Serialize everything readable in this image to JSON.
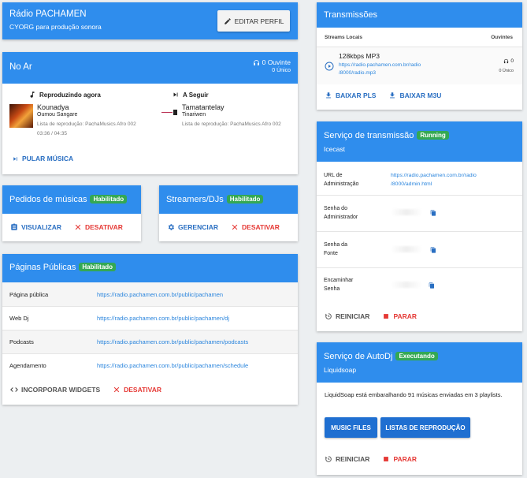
{
  "station": {
    "title": "Rádio PACHAMEN",
    "subtitle": "CYORG para produção sonora",
    "edit_label": "EDITAR PERFIL"
  },
  "onair": {
    "title": "No Ar",
    "listeners": "0 Ouvinte",
    "unique": "0 Único",
    "now_label": "Reproduzindo agora",
    "now_song": "Kounadya",
    "now_artist": "Oumou Sangare",
    "now_playlist": "Lista de reprodução: PachaMusics Afro 002",
    "now_time": "03:36 / 04:35",
    "next_label": "A Seguir",
    "next_song": "Tamatantelay",
    "next_artist": "Tinariwen",
    "next_playlist": "Lista de reprodução: PachaMusics Afro 002",
    "skip_label": "PULAR MÚSICA"
  },
  "requests": {
    "title": "Pedidos de músicas",
    "badge": "Habilitado",
    "view_label": "VISUALIZAR",
    "disable_label": "DESATIVAR"
  },
  "streamers": {
    "title": "Streamers/DJs",
    "badge": "Habilitado",
    "manage_label": "GERENCIAR",
    "disable_label": "DESATIVAR"
  },
  "public_pages": {
    "title": "Páginas Públicas",
    "badge": "Habilitado",
    "rows": [
      {
        "label": "Página pública",
        "url": "https://radio.pachamen.com.br/public/pachamen"
      },
      {
        "label": "Web Dj",
        "url": "https://radio.pachamen.com.br/public/pachamen/dj"
      },
      {
        "label": "Podcasts",
        "url": "https://radio.pachamen.com.br/public/pachamen/podcasts"
      },
      {
        "label": "Agendamento",
        "url": "https://radio.pachamen.com.br/public/pachamen/schedule"
      }
    ],
    "embed_label": "INCORPORAR WIDGETS",
    "disable_label": "DESATIVAR"
  },
  "streams": {
    "title": "Transmissões",
    "col_local": "Streams Locais",
    "col_listeners": "Ouvintes",
    "stream_name": "128kbps MP3",
    "stream_url_1": "https://radio.pachamen.com.br/radio",
    "stream_url_2": "/8000/radio.mp3",
    "stream_listeners": "0",
    "stream_unique": "0 Único",
    "pls_label": "BAIXAR PLS",
    "m3u_label": "BAIXAR M3U"
  },
  "broadcast": {
    "title": "Serviço de transmissão",
    "badge": "Running",
    "subtitle": "Icecast",
    "admin_url_label_1": "URL de",
    "admin_url_label_2": "Administração",
    "admin_url_1": "https://radio.pachamen.com.br/radio",
    "admin_url_2": "/8000/admin.html",
    "admin_pw_label_1": "Senha do",
    "admin_pw_label_2": "Administrador",
    "source_pw_label_1": "Senha da",
    "source_pw_label_2": "Fonte",
    "relay_pw_label_1": "Encaminhar",
    "relay_pw_label_2": "Senha",
    "restart_label": "REINICIAR",
    "stop_label": "PARAR"
  },
  "autodj": {
    "title": "Serviço de AutoDj",
    "badge": "Executando",
    "subtitle": "Liquidsoap",
    "desc": "LiquidSoap está embaralhando 91 músicas enviadas em 3 playlists.",
    "music_files_label": "MUSIC FILES",
    "playlists_label": "LISTAS DE REPRODUÇÃO",
    "restart_label": "REINICIAR",
    "stop_label": "PARAR"
  },
  "colors": {
    "header_blue": "#2f8ded",
    "badge_green": "#34a853",
    "danger_red": "#e53935",
    "link_blue": "#2a85dd"
  }
}
